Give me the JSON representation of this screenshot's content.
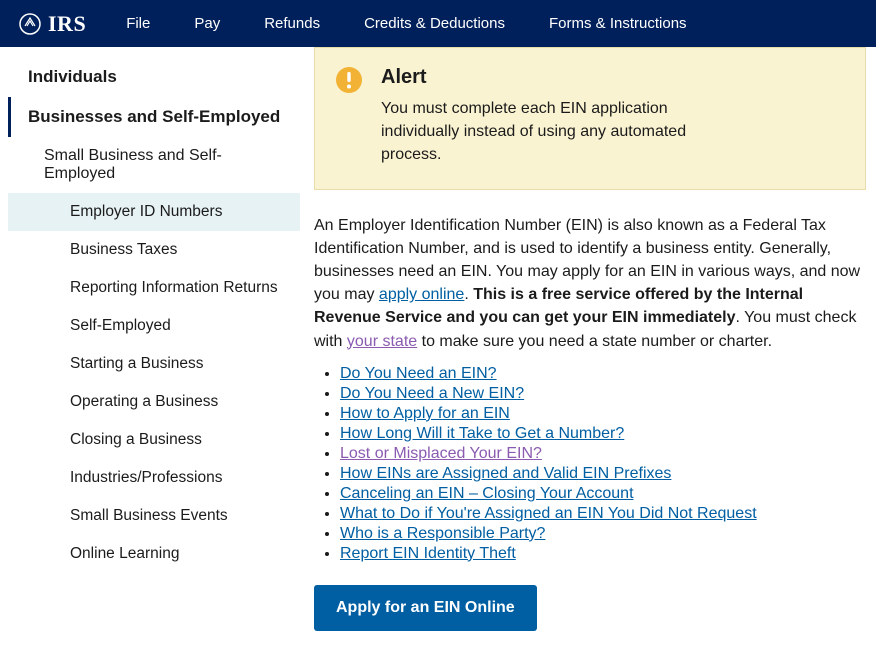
{
  "header": {
    "logo_text": "IRS",
    "nav": [
      "File",
      "Pay",
      "Refunds",
      "Credits & Deductions",
      "Forms & Instructions"
    ]
  },
  "sidebar": {
    "top": "Individuals",
    "active_parent": "Businesses and Self-Employed",
    "sub_items": [
      {
        "label": "Small Business and Self-Employed",
        "level": "sub",
        "current": false
      },
      {
        "label": "Employer ID Numbers",
        "level": "subsub",
        "current": true
      },
      {
        "label": "Business Taxes",
        "level": "subsub",
        "current": false
      },
      {
        "label": "Reporting Information Returns",
        "level": "subsub",
        "current": false
      },
      {
        "label": "Self-Employed",
        "level": "subsub",
        "current": false
      },
      {
        "label": "Starting a Business",
        "level": "subsub",
        "current": false
      },
      {
        "label": "Operating a Business",
        "level": "subsub",
        "current": false
      },
      {
        "label": "Closing a Business",
        "level": "subsub",
        "current": false
      },
      {
        "label": "Industries/Professions",
        "level": "subsub",
        "current": false
      },
      {
        "label": "Small Business Events",
        "level": "subsub",
        "current": false
      },
      {
        "label": "Online Learning",
        "level": "subsub",
        "current": false
      }
    ]
  },
  "alert": {
    "title": "Alert",
    "body": "You must complete each EIN application individually instead of using any automated process."
  },
  "intro": {
    "p1_a": "An Employer Identification Number (EIN) is also known as a Federal Tax Identification Number, and is used to identify a business entity. Generally, businesses need an EIN. You may apply for an EIN in various ways, and now you may ",
    "apply_online": "apply online",
    "p1_b": ". ",
    "bold": "This is a free service offered by the Internal Revenue Service and you can get your EIN immediately",
    "p1_c": ". You must check with ",
    "your_state": "your state",
    "p1_d": " to make sure you need a state number or charter."
  },
  "links": [
    {
      "text": "Do You Need an EIN?",
      "visited": false
    },
    {
      "text": "Do You Need a New EIN?",
      "visited": false
    },
    {
      "text": "How to Apply for an EIN",
      "visited": false
    },
    {
      "text": "How Long Will it Take to Get a Number?",
      "visited": false
    },
    {
      "text": "Lost or Misplaced Your EIN?",
      "visited": true
    },
    {
      "text": "How EINs are Assigned and Valid EIN Prefixes",
      "visited": false
    },
    {
      "text": "Canceling an EIN – Closing Your Account",
      "visited": false
    },
    {
      "text": "What to Do if You're Assigned an EIN You Did Not Request",
      "visited": false
    },
    {
      "text": "Who is a Responsible Party?",
      "visited": false
    },
    {
      "text": "Report EIN Identity Theft",
      "visited": false
    }
  ],
  "cta": {
    "label": "Apply for an EIN Online"
  }
}
